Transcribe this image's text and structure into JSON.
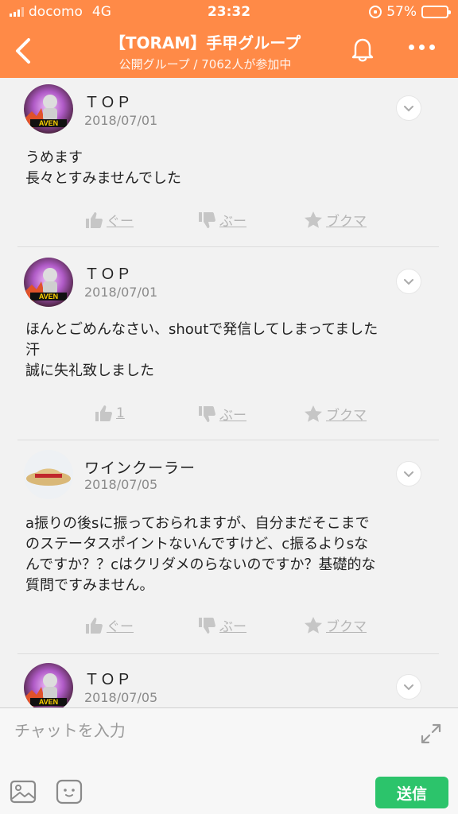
{
  "status": {
    "carrier": "docomo",
    "network": "4G",
    "time": "23:32",
    "battery": "57%",
    "battery_level": 0.57
  },
  "header": {
    "title": "【TORAM】手甲グループ",
    "subtitle": "公開グループ / 7062人が参加中"
  },
  "posts": [
    {
      "user": "ＴＯＰ",
      "date": "2018/07/01",
      "body": "うめます\n長々とすみませんでした",
      "like": "ぐー",
      "dislike": "ぶー",
      "bookmark": "ブクマ"
    },
    {
      "user": "ＴＯＰ",
      "date": "2018/07/01",
      "body": "ほんとごめんなさい、shoutで発信してしまってました\n汗\n誠に失礼致しました",
      "like": "1",
      "dislike": "ぶー",
      "bookmark": "ブクマ"
    },
    {
      "user": "ワインクーラー",
      "date": "2018/07/05",
      "body": "a振りの後sに振っておられますが、自分まだそこまで\nのステータスポイントないんですけど、c振るよりsな\nんですか？？cはクリダメのらないのですか？基礎的な\n質問ですみません。",
      "like": "ぐー",
      "dislike": "ぶー",
      "bookmark": "ブクマ"
    },
    {
      "user": "ＴＯＰ",
      "date": "2018/07/05"
    }
  ],
  "composer": {
    "placeholder": "チャットを入力",
    "send": "送信"
  },
  "colors": {
    "accent": "#ff8a47",
    "send": "#2cc46b"
  }
}
